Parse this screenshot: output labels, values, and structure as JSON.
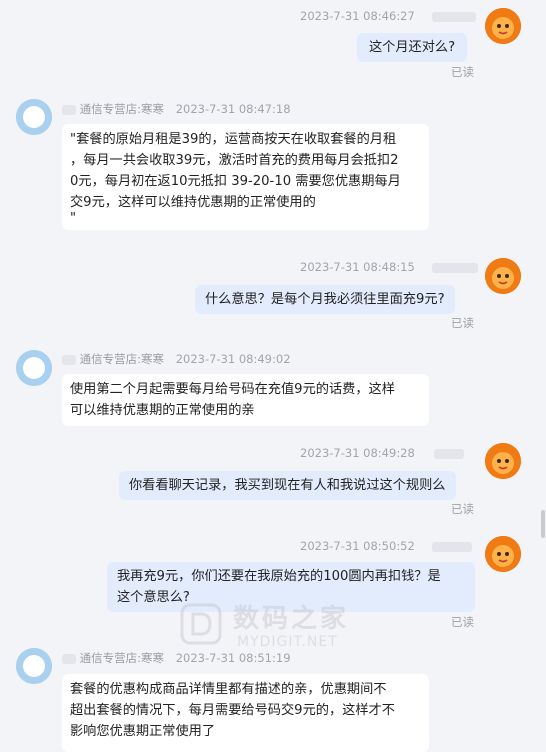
{
  "read_label": "已读",
  "shop_name": "通信专营店:寒寒",
  "messages": [
    {
      "time": "2023-7-31 08:46:27",
      "text": "这个月还对么?"
    },
    {
      "time": "2023-7-31 08:47:18",
      "lines": [
        "\"套餐的原始月租是39的，运营商按天在收取套餐的月租",
        "，每月一共会收取39元，激活时首充的费用每月会抵扣2",
        "0元，每月初在返10元抵扣 39-20-10 需要您优惠期每月",
        "交9元，这样可以维持优惠期的正常使用的",
        "\""
      ]
    },
    {
      "time": "2023-7-31 08:48:15",
      "text": "什么意思？是每个月我必须往里面充9元?"
    },
    {
      "time": "2023-7-31 08:49:02",
      "lines": [
        "使用第二个月起需要每月给号码在充值9元的话费，这样",
        "可以维持优惠期的正常使用的亲"
      ]
    },
    {
      "time": "2023-7-31 08:49:28",
      "text": "你看看聊天记录，我买到现在有人和我说过这个规则么"
    },
    {
      "time": "2023-7-31 08:50:52",
      "lines": [
        "我再充9元，你们还要在我原始充的100圆内再扣钱？是",
        "这个意思么?"
      ]
    },
    {
      "time": "2023-7-31 08:51:19",
      "lines": [
        "套餐的优惠构成商品详情里都有描述的亲，优惠期间不",
        "超出套餐的情况下，每月需要给号码交9元的，这样才不",
        "影响您优惠期正常使用了"
      ]
    }
  ],
  "watermark": {
    "title": "数码之家",
    "url": "MYDIGIT.NET"
  }
}
